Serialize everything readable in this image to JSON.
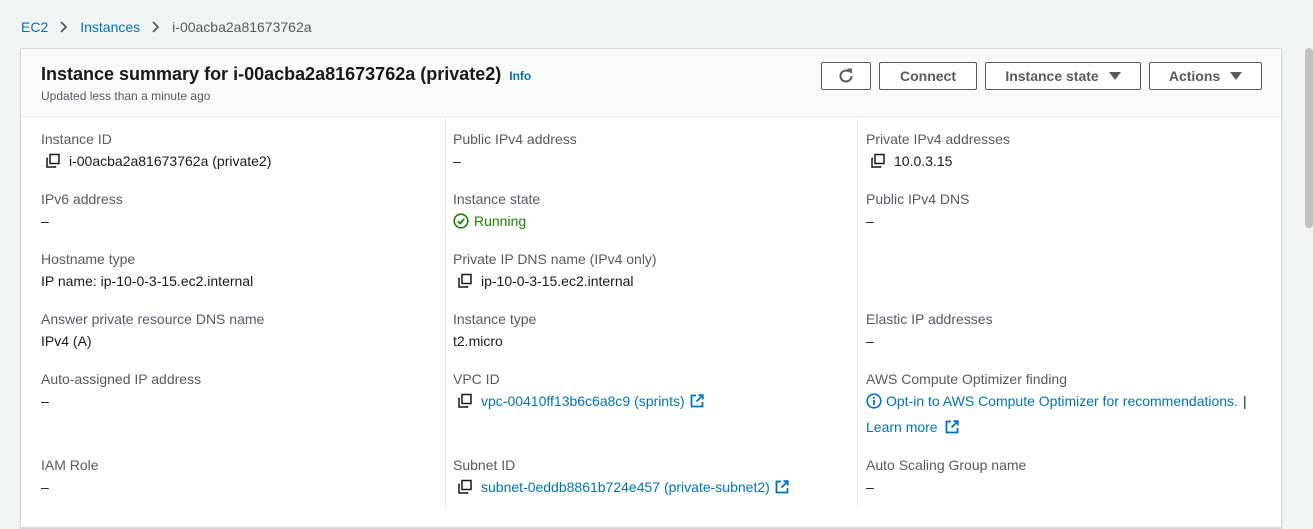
{
  "breadcrumb": {
    "items": [
      "EC2",
      "Instances"
    ],
    "current": "i-00acba2a81673762a"
  },
  "header": {
    "title": "Instance summary for i-00acba2a81673762a (private2)",
    "info": "Info",
    "subtitle": "Updated less than a minute ago"
  },
  "toolbar": {
    "connect": "Connect",
    "instance_state": "Instance state",
    "actions": "Actions"
  },
  "fields": {
    "instance_id": {
      "label": "Instance ID",
      "value": "i-00acba2a81673762a (private2)"
    },
    "ipv6": {
      "label": "IPv6 address",
      "value": "–"
    },
    "hostname_type": {
      "label": "Hostname type",
      "value": "IP name: ip-10-0-3-15.ec2.internal"
    },
    "answer_dns": {
      "label": "Answer private resource DNS name",
      "value": "IPv4 (A)"
    },
    "auto_ip": {
      "label": "Auto-assigned IP address",
      "value": "–"
    },
    "iam_role": {
      "label": "IAM Role",
      "value": "–"
    },
    "public_ipv4": {
      "label": "Public IPv4 address",
      "value": "–"
    },
    "instance_state": {
      "label": "Instance state",
      "value": "Running"
    },
    "private_dns": {
      "label": "Private IP DNS name (IPv4 only)",
      "value": "ip-10-0-3-15.ec2.internal"
    },
    "instance_type": {
      "label": "Instance type",
      "value": "t2.micro"
    },
    "vpc_id": {
      "label": "VPC ID",
      "value": "vpc-00410ff13b6c6a8c9 (sprints)"
    },
    "subnet_id": {
      "label": "Subnet ID",
      "value": "subnet-0eddb8861b724e457 (private-subnet2)"
    },
    "private_ipv4": {
      "label": "Private IPv4 addresses",
      "value": "10.0.3.15"
    },
    "public_dns": {
      "label": "Public IPv4 DNS",
      "value": "–"
    },
    "elastic_ip": {
      "label": "Elastic IP addresses",
      "value": "–"
    },
    "optimizer": {
      "label": "AWS Compute Optimizer finding",
      "link": "Opt-in to AWS Compute Optimizer for recommendations.",
      "separator": "|",
      "learn_more": "Learn more"
    },
    "asg": {
      "label": "Auto Scaling Group name",
      "value": "–"
    }
  },
  "colors": {
    "link": "#0073bb",
    "success": "#1d8102",
    "text": "#16191f",
    "muted": "#545b64"
  },
  "icons": [
    "chevron-right-icon",
    "refresh-icon",
    "caret-down-icon",
    "copy-icon",
    "check-circle-icon",
    "external-link-icon",
    "info-circle-icon"
  ]
}
